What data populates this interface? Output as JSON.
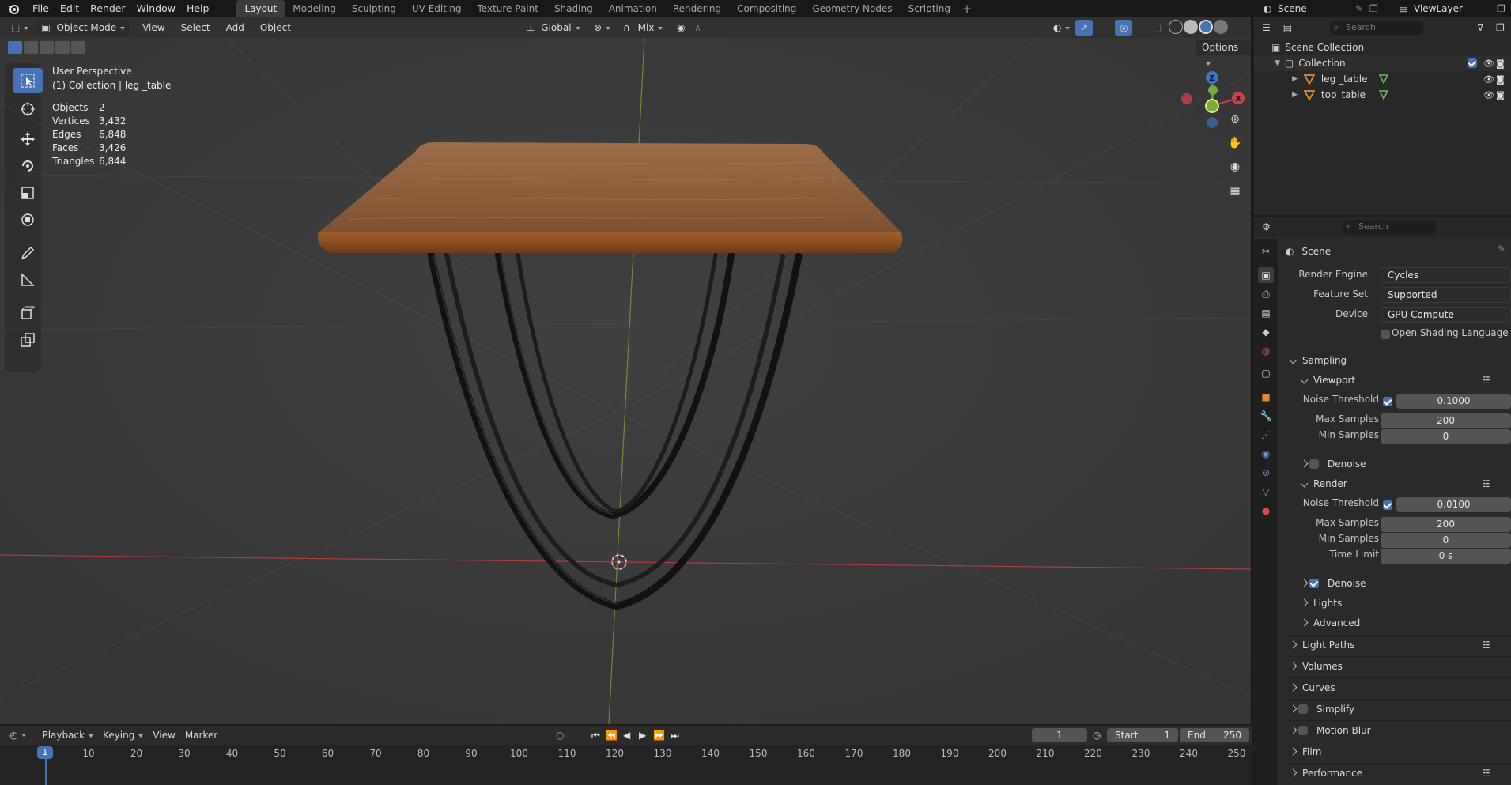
{
  "topbar": {
    "menus": [
      "File",
      "Edit",
      "Render",
      "Window",
      "Help"
    ],
    "workspaces": [
      "Layout",
      "Modeling",
      "Sculpting",
      "UV Editing",
      "Texture Paint",
      "Shading",
      "Animation",
      "Rendering",
      "Compositing",
      "Geometry Nodes",
      "Scripting"
    ],
    "active_workspace": "Layout",
    "scene_name": "Scene",
    "view_layer": "ViewLayer"
  },
  "viewport": {
    "mode": "Object Mode",
    "menus": [
      "View",
      "Select",
      "Add",
      "Object"
    ],
    "transform_orientation": "Global",
    "snap_mode": "Mix",
    "options_label": "Options",
    "perspective_label": "User Perspective",
    "collection_label": "(1) Collection | leg _table",
    "stats": [
      {
        "label": "Objects",
        "value": "2"
      },
      {
        "label": "Vertices",
        "value": "3,432"
      },
      {
        "label": "Edges",
        "value": "6,848"
      },
      {
        "label": "Faces",
        "value": "3,426"
      },
      {
        "label": "Triangles",
        "value": "6,844"
      }
    ],
    "gizmo_axes": {
      "x": "X",
      "y": "Y",
      "z": "Z"
    }
  },
  "outliner": {
    "search_placeholder": "Search",
    "root": "Scene Collection",
    "collection": "Collection",
    "objects": [
      "leg _table",
      "top_table"
    ]
  },
  "properties": {
    "search_placeholder": "Search",
    "context": "Scene",
    "render_engine_label": "Render Engine",
    "render_engine": "Cycles",
    "feature_set_label": "Feature Set",
    "feature_set": "Supported",
    "device_label": "Device",
    "device": "GPU Compute",
    "osl_label": "Open Shading Language",
    "osl_checked": false,
    "sampling": {
      "title": "Sampling",
      "viewport": {
        "title": "Viewport",
        "noise_threshold_label": "Noise Threshold",
        "noise_threshold": "0.1000",
        "max_samples_label": "Max Samples",
        "max_samples": "200",
        "min_samples_label": "Min Samples",
        "min_samples": "0",
        "denoise_label": "Denoise",
        "denoise_checked": false
      },
      "render": {
        "title": "Render",
        "noise_threshold_label": "Noise Threshold",
        "noise_threshold": "0.0100",
        "max_samples_label": "Max Samples",
        "max_samples": "200",
        "min_samples_label": "Min Samples",
        "min_samples": "0",
        "time_limit_label": "Time Limit",
        "time_limit": "0 s",
        "denoise_label": "Denoise",
        "denoise_checked": true
      },
      "lights_label": "Lights",
      "advanced_label": "Advanced"
    },
    "panels": [
      "Light Paths",
      "Volumes",
      "Curves",
      "Simplify",
      "Motion Blur",
      "Film",
      "Performance"
    ]
  },
  "timeline": {
    "menus": [
      "Playback",
      "Keying",
      "View",
      "Marker"
    ],
    "current_frame": "1",
    "start_label": "Start",
    "start": "1",
    "end_label": "End",
    "end": "250",
    "ruler": [
      "1",
      "10",
      "20",
      "30",
      "40",
      "50",
      "60",
      "70",
      "80",
      "90",
      "100",
      "110",
      "120",
      "130",
      "140",
      "150",
      "160",
      "170",
      "180",
      "190",
      "200",
      "210",
      "220",
      "230",
      "240",
      "250"
    ]
  },
  "colors": {
    "accent": "#4772b3",
    "x_axis": "#c8414c",
    "y_axis": "#7aa83a",
    "z_axis": "#3c78c8",
    "wood": "#8a5530",
    "mesh_icon": "#e08b3c"
  }
}
